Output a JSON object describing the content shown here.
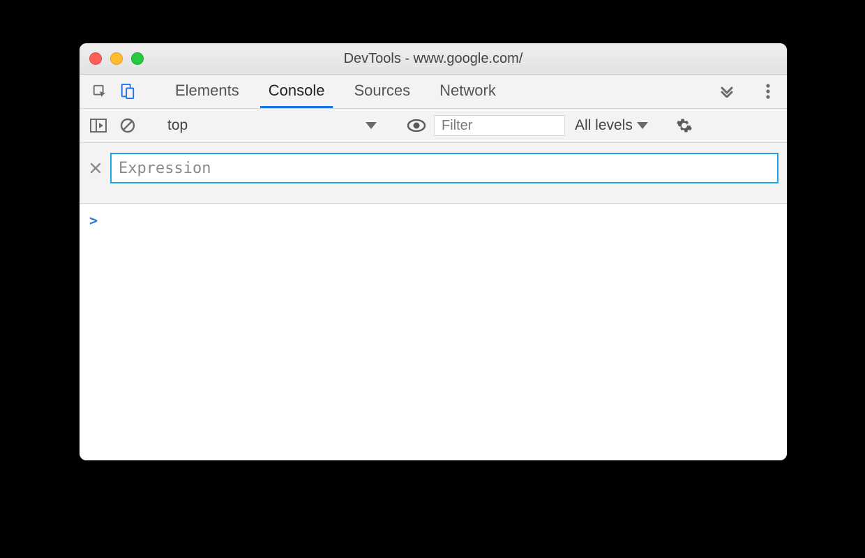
{
  "window": {
    "title": "DevTools - www.google.com/"
  },
  "tabs": {
    "items": [
      "Elements",
      "Console",
      "Sources",
      "Network"
    ],
    "active": "Console"
  },
  "toolbar": {
    "context": "top",
    "filter_placeholder": "Filter",
    "levels_label": "All levels"
  },
  "live_expression": {
    "placeholder": "Expression",
    "value": ""
  },
  "console": {
    "prompt": ">"
  }
}
